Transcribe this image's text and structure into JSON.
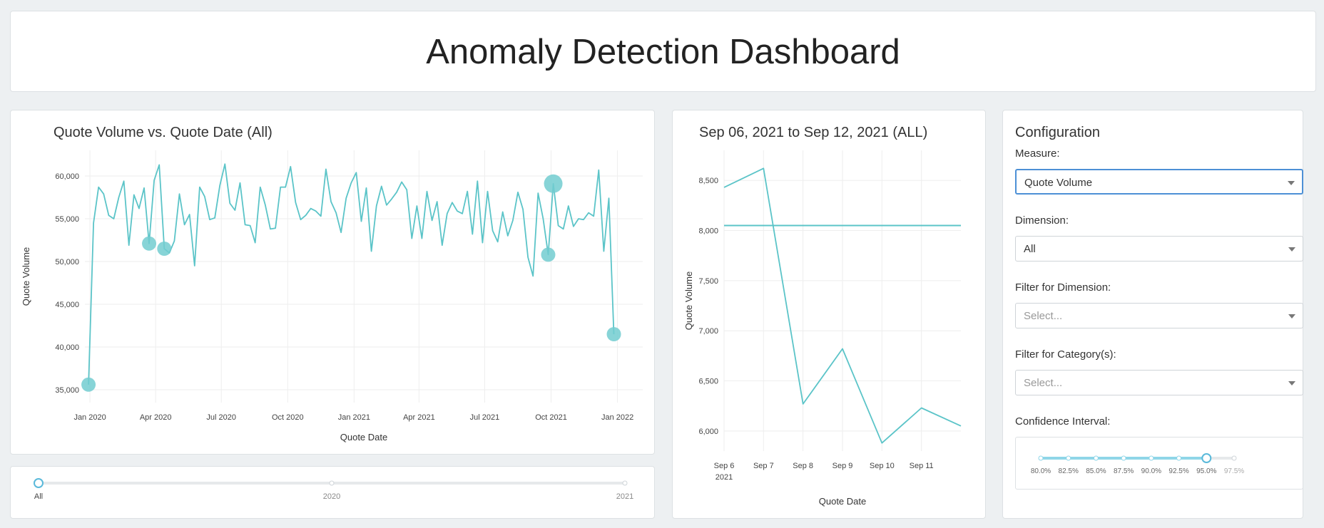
{
  "header": {
    "title": "Anomaly Detection Dashboard"
  },
  "colors": {
    "line": "#5bc4c8",
    "anomaly": "#72cdd0",
    "grid": "#eeeeee",
    "track": "#e6e9eb",
    "accent": "#4d90d6",
    "slider_fill": "#8fd6e8",
    "header_text": "#222222",
    "background": "#edf0f2"
  },
  "main_chart": {
    "title": "Quote Volume vs. Quote Date (All)",
    "tick_labels_x": [
      "Jan 2020",
      "Apr 2020",
      "Jul 2020",
      "Oct 2020",
      "Jan 2021",
      "Apr 2021",
      "Jul 2021",
      "Oct 2021",
      "Jan 2022"
    ],
    "tick_labels_y": [
      "35,000",
      "40,000",
      "45,000",
      "50,000",
      "55,000",
      "60,000"
    ]
  },
  "week_chart": {
    "title": "Sep 06, 2021 to Sep 12, 2021 (ALL)",
    "tick_labels_x": [
      "Sep 6",
      "Sep 7",
      "Sep 8",
      "Sep 9",
      "Sep 10",
      "Sep 11"
    ],
    "tick_year": "2021",
    "tick_labels_y": [
      "6,000",
      "6,500",
      "7,000",
      "7,500",
      "8,000",
      "8,500"
    ]
  },
  "chart_data": [
    {
      "type": "line",
      "title": "Quote Volume vs. Quote Date (All)",
      "xlabel": "Quote Date",
      "ylabel": "Quote Volume",
      "xlim": [
        "2019-12-25",
        "2022-02-05"
      ],
      "ylim": [
        33500,
        63000
      ],
      "x_ticks": [
        "2020-01-01",
        "2020-04-01",
        "2020-07-01",
        "2020-10-01",
        "2021-01-01",
        "2021-04-01",
        "2021-07-01",
        "2021-10-01",
        "2022-01-01"
      ],
      "y_ticks": [
        35000,
        40000,
        45000,
        50000,
        55000,
        60000
      ],
      "grid": true,
      "series": [
        {
          "values": [
            [
              "2019-12-30",
              35600
            ],
            [
              "2020-01-06",
              54500
            ],
            [
              "2020-01-13",
              58700
            ],
            [
              "2020-01-20",
              57900
            ],
            [
              "2020-01-27",
              55400
            ],
            [
              "2020-02-03",
              55000
            ],
            [
              "2020-02-10",
              57500
            ],
            [
              "2020-02-17",
              59400
            ],
            [
              "2020-02-24",
              51900
            ],
            [
              "2020-03-02",
              57800
            ],
            [
              "2020-03-09",
              56200
            ],
            [
              "2020-03-16",
              58600
            ],
            [
              "2020-03-23",
              52100
            ],
            [
              "2020-03-30",
              59500
            ],
            [
              "2020-04-06",
              61300
            ],
            [
              "2020-04-13",
              51500
            ],
            [
              "2020-04-20",
              51000
            ],
            [
              "2020-04-27",
              52400
            ],
            [
              "2020-05-04",
              57900
            ],
            [
              "2020-05-11",
              54300
            ],
            [
              "2020-05-18",
              55500
            ],
            [
              "2020-05-25",
              49500
            ],
            [
              "2020-06-01",
              58700
            ],
            [
              "2020-06-08",
              57600
            ],
            [
              "2020-06-15",
              54900
            ],
            [
              "2020-06-22",
              55100
            ],
            [
              "2020-06-29",
              58900
            ],
            [
              "2020-07-06",
              61400
            ],
            [
              "2020-07-13",
              56800
            ],
            [
              "2020-07-20",
              56000
            ],
            [
              "2020-07-27",
              59200
            ],
            [
              "2020-08-03",
              54300
            ],
            [
              "2020-08-10",
              54200
            ],
            [
              "2020-08-17",
              52200
            ],
            [
              "2020-08-24",
              58700
            ],
            [
              "2020-08-31",
              56600
            ],
            [
              "2020-09-07",
              53800
            ],
            [
              "2020-09-14",
              53900
            ],
            [
              "2020-09-21",
              58700
            ],
            [
              "2020-09-28",
              58700
            ],
            [
              "2020-10-05",
              61100
            ],
            [
              "2020-10-12",
              56900
            ],
            [
              "2020-10-19",
              54900
            ],
            [
              "2020-10-26",
              55400
            ],
            [
              "2020-11-02",
              56200
            ],
            [
              "2020-11-09",
              55900
            ],
            [
              "2020-11-16",
              55300
            ],
            [
              "2020-11-23",
              60800
            ],
            [
              "2020-11-30",
              57000
            ],
            [
              "2020-12-07",
              55700
            ],
            [
              "2020-12-14",
              53400
            ],
            [
              "2020-12-21",
              57400
            ],
            [
              "2020-12-28",
              59200
            ],
            [
              "2021-01-04",
              60400
            ],
            [
              "2021-01-11",
              54700
            ],
            [
              "2021-01-18",
              58600
            ],
            [
              "2021-01-25",
              51200
            ],
            [
              "2021-02-01",
              56500
            ],
            [
              "2021-02-08",
              58800
            ],
            [
              "2021-02-15",
              56600
            ],
            [
              "2021-02-22",
              57300
            ],
            [
              "2021-03-01",
              58100
            ],
            [
              "2021-03-08",
              59300
            ],
            [
              "2021-03-15",
              58400
            ],
            [
              "2021-03-22",
              52700
            ],
            [
              "2021-03-29",
              56500
            ],
            [
              "2021-04-05",
              52700
            ],
            [
              "2021-04-12",
              58200
            ],
            [
              "2021-04-19",
              54800
            ],
            [
              "2021-04-26",
              57000
            ],
            [
              "2021-05-03",
              51900
            ],
            [
              "2021-05-10",
              55600
            ],
            [
              "2021-05-17",
              56900
            ],
            [
              "2021-05-24",
              55900
            ],
            [
              "2021-05-31",
              55600
            ],
            [
              "2021-06-07",
              58200
            ],
            [
              "2021-06-14",
              53200
            ],
            [
              "2021-06-21",
              59400
            ],
            [
              "2021-06-28",
              52200
            ],
            [
              "2021-07-05",
              58200
            ],
            [
              "2021-07-12",
              53600
            ],
            [
              "2021-07-19",
              52300
            ],
            [
              "2021-07-26",
              55800
            ],
            [
              "2021-08-02",
              53000
            ],
            [
              "2021-08-09",
              54800
            ],
            [
              "2021-08-16",
              58100
            ],
            [
              "2021-08-23",
              56100
            ],
            [
              "2021-08-30",
              50500
            ],
            [
              "2021-09-06",
              48300
            ],
            [
              "2021-09-13",
              58000
            ],
            [
              "2021-09-20",
              55000
            ],
            [
              "2021-09-27",
              50800
            ],
            [
              "2021-10-04",
              59100
            ],
            [
              "2021-10-11",
              54200
            ],
            [
              "2021-10-18",
              53800
            ],
            [
              "2021-10-25",
              56500
            ],
            [
              "2021-11-01",
              54100
            ],
            [
              "2021-11-08",
              55000
            ],
            [
              "2021-11-15",
              54900
            ],
            [
              "2021-11-22",
              55700
            ],
            [
              "2021-11-29",
              55300
            ],
            [
              "2021-12-06",
              60700
            ],
            [
              "2021-12-13",
              51200
            ],
            [
              "2021-12-20",
              57400
            ],
            [
              "2021-12-27",
              41500
            ]
          ]
        }
      ],
      "anomalies": [
        {
          "x": "2019-12-30",
          "y": 35600,
          "size": "small"
        },
        {
          "x": "2020-03-23",
          "y": 52100,
          "size": "small"
        },
        {
          "x": "2020-04-13",
          "y": 51500,
          "size": "small"
        },
        {
          "x": "2021-09-27",
          "y": 50800,
          "size": "small"
        },
        {
          "x": "2021-10-04",
          "y": 59100,
          "size": "large"
        },
        {
          "x": "2021-12-27",
          "y": 41500,
          "size": "small"
        }
      ]
    },
    {
      "type": "line",
      "title": "Sep 06, 2021 to Sep 12, 2021 (ALL)",
      "xlabel": "Quote Date",
      "ylabel": "Quote Volume",
      "xlim": [
        "2021-09-06",
        "2021-09-12"
      ],
      "ylim": [
        5800,
        8800
      ],
      "x_ticks": [
        "2021-09-06",
        "2021-09-07",
        "2021-09-08",
        "2021-09-09",
        "2021-09-10",
        "2021-09-11"
      ],
      "y_ticks": [
        6000,
        6500,
        7000,
        7500,
        8000,
        8500
      ],
      "grid": true,
      "series": [
        {
          "values": [
            [
              "2021-09-06",
              8430
            ],
            [
              "2021-09-07",
              8620
            ],
            [
              "2021-09-08",
              6270
            ],
            [
              "2021-09-09",
              6820
            ],
            [
              "2021-09-10",
              5880
            ],
            [
              "2021-09-11",
              6230
            ],
            [
              "2021-09-12",
              6050
            ]
          ]
        }
      ],
      "reference_line": 8050
    }
  ],
  "period_slider": {
    "labels": [
      "All",
      "2020",
      "2021"
    ],
    "selected_index": 0
  },
  "config": {
    "title": "Configuration",
    "measure": {
      "label": "Measure:",
      "value": "Quote Volume"
    },
    "dimension": {
      "label": "Dimension:",
      "value": "All"
    },
    "filter_dimension": {
      "label": "Filter for Dimension:",
      "placeholder": "Select..."
    },
    "filter_category": {
      "label": "Filter for Category(s):",
      "placeholder": "Select..."
    },
    "confidence": {
      "label": "Confidence Interval:",
      "options": [
        "80.0%",
        "82.5%",
        "85.0%",
        "87.5%",
        "90.0%",
        "92.5%",
        "95.0%",
        "97.5%"
      ],
      "selected_index": 6
    }
  }
}
